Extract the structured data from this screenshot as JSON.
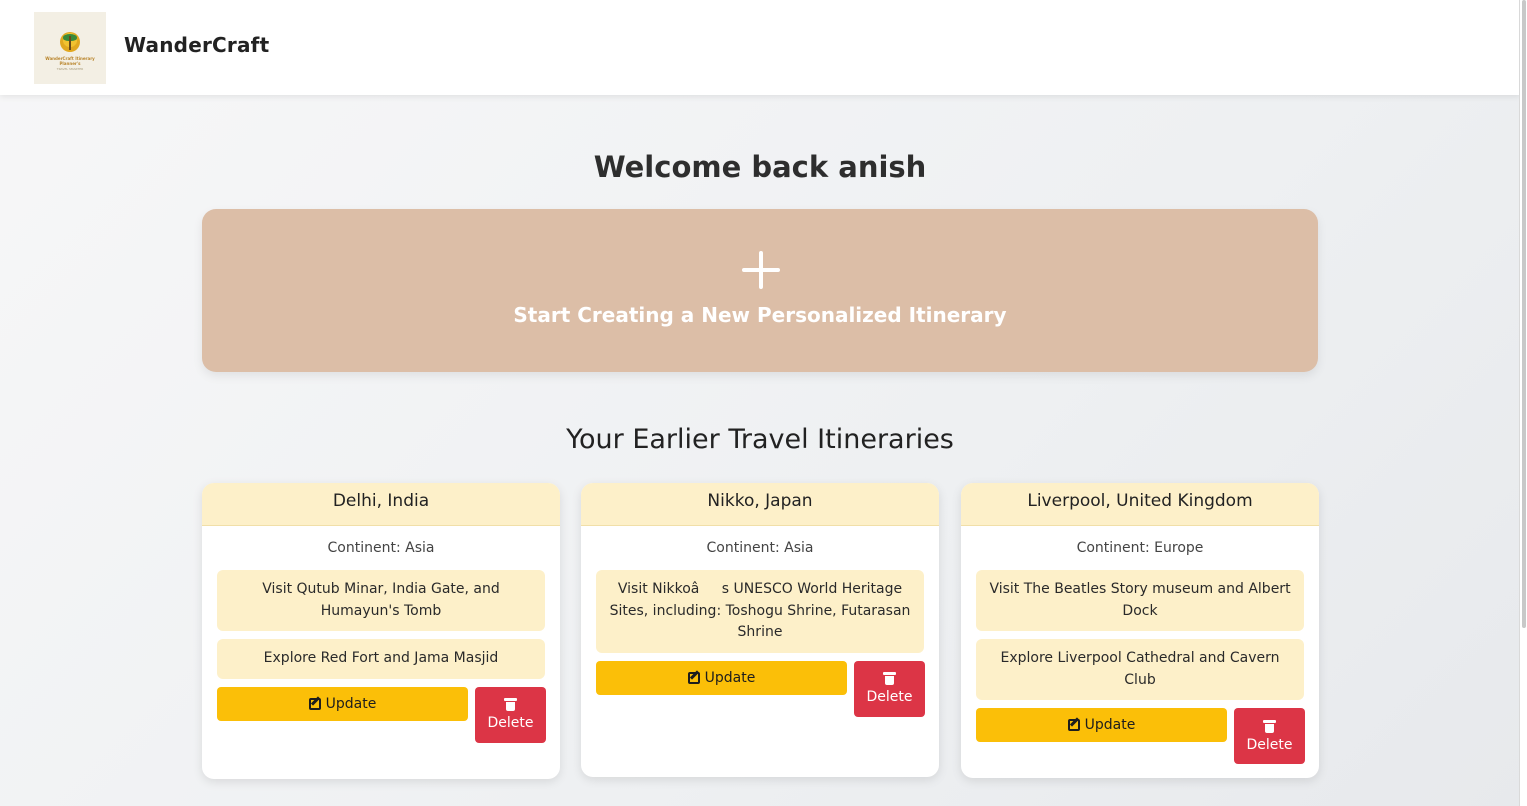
{
  "app": {
    "brand": "WanderCraft",
    "logo_text": "WanderCraft Itinerary Planner's",
    "logo_subtext": "TRAVEL SMARTER"
  },
  "welcome": {
    "title": "Welcome back anish"
  },
  "create": {
    "label": "Start Creating a New Personalized Itinerary",
    "icon": "plus-icon"
  },
  "itineraries": {
    "title": "Your Earlier Travel Itineraries",
    "update_label": "Update",
    "delete_label": "Delete",
    "items": [
      {
        "destination": "Delhi, India",
        "continent": "Continent: Asia",
        "activities": [
          "Visit Qutub Minar, India Gate, and Humayun's Tomb",
          "Explore Red Fort and Jama Masjid"
        ]
      },
      {
        "destination": "Nikko, Japan",
        "continent": "Continent: Asia",
        "activities": [
          "Visit Nikkoâs UNESCO World Heritage Sites, including: Toshogu Shrine, Futarasan Shrine"
        ]
      },
      {
        "destination": "Liverpool, United Kingdom",
        "continent": "Continent: Europe",
        "activities": [
          "Visit The Beatles Story museum and Albert Dock",
          "Explore Liverpool Cathedral and Cavern Club"
        ]
      }
    ]
  },
  "colors": {
    "create_card": "#dcbea7",
    "card_header": "#fdf0c9",
    "update_button": "#fbbf08",
    "delete_button": "#dc3546"
  }
}
